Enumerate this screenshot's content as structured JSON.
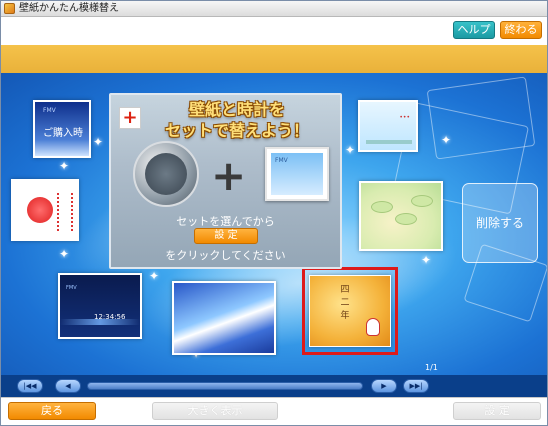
{
  "window": {
    "title": "壁紙かんたん模様替え"
  },
  "header": {
    "help_label": "ヘルプ",
    "exit_label": "終わる"
  },
  "panel": {
    "headline_line1": "壁紙と時計を",
    "headline_line2": "セットで替えよう！",
    "badge": "+",
    "plus_sign": "+",
    "photo_brand": "FMV",
    "hint_top": "セットを選んでから",
    "set_label": "設 定",
    "hint_bottom": "をクリックしてください"
  },
  "thumbnails": {
    "purchase": {
      "brand": "FMV",
      "label": "ご購入時"
    },
    "night_clock": {
      "brand": "FMV",
      "time": "12:34:56"
    },
    "new_year_kanji": "四\n二\n年"
  },
  "delete_label": "削除する",
  "page_indicator": "1/1",
  "scroll": {
    "first": "|◀◀",
    "prev": "◀",
    "next": "▶",
    "last": "▶▶|"
  },
  "footer": {
    "back_label": "戻る",
    "enlarge_label": "大きく表示",
    "set_label": "設 定"
  },
  "colors": {
    "accent_orange": "#f28a00",
    "accent_teal": "#1b9aa3",
    "selection_red": "#dd1a1a",
    "stage_blue": "#1c72d4"
  }
}
